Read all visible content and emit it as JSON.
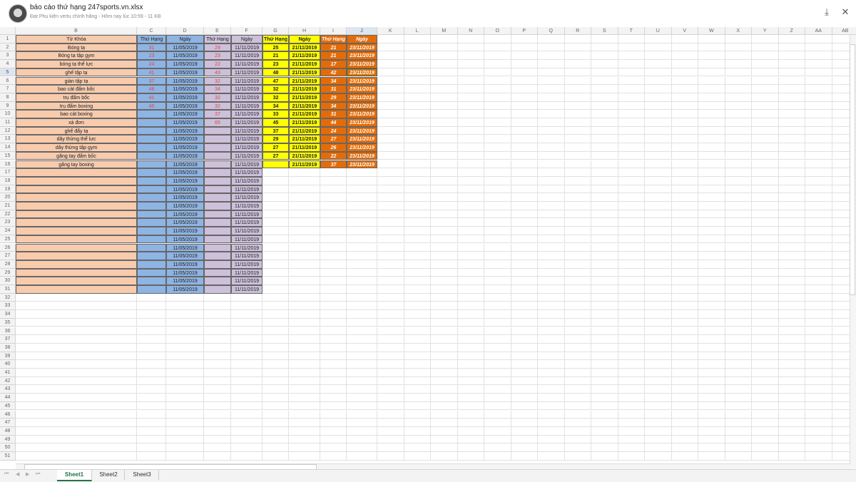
{
  "header": {
    "title": "báo cáo thứ hạng 247sports.vn.xlsx",
    "subtitle": "Đạt Phụ kiện vertu chính hãng - Hôm nay lúc 10:59 - 11 KB",
    "avatar_icon": "avatar-icon",
    "download_icon": "download-icon",
    "close_icon": "close-icon"
  },
  "columns": [
    "B",
    "C",
    "D",
    "E",
    "F",
    "G",
    "H",
    "I",
    "J",
    "K",
    "L",
    "M",
    "N",
    "O",
    "P",
    "Q",
    "R",
    "S",
    "T",
    "U",
    "V",
    "W",
    "X",
    "Y",
    "Z",
    "AA",
    "AB"
  ],
  "selected": {
    "column": "J",
    "row": "5"
  },
  "table_headers": {
    "B": "Từ Khóa",
    "C": "Thứ Hạng",
    "D": "Ngày",
    "E": "Thứ Hạng",
    "F": "Ngày",
    "G": "Thứ Hạng",
    "H": "Ngày",
    "I": "Thứ Hạng",
    "J": "Ngày"
  },
  "keywords": [
    "Bóng tạ",
    "Bóng tạ tập gym",
    "bóng tạ thể lực",
    "ghế tập tạ",
    "giàn tập tạ",
    "bao cát đấm bốc",
    "trụ đấm bốc",
    "trụ đấm boxing",
    "bao cát boxing",
    "xà đơn",
    "ghế đẩy tạ",
    "dây thừng thể lực",
    "dây thừng tập gym",
    "găng tay đấm bốc",
    "găng tay boxing"
  ],
  "rank_c": [
    "31",
    "23",
    "24",
    "41",
    "37",
    "48",
    "41",
    "45"
  ],
  "rank_e": [
    "29",
    "23",
    "22",
    "43",
    "32",
    "34",
    "32",
    "32",
    "37",
    "65"
  ],
  "rank_g": [
    "25",
    "21",
    "23",
    "48",
    "47",
    "32",
    "32",
    "34",
    "33",
    "45",
    "37",
    "29",
    "27",
    "27",
    ""
  ],
  "rank_i": [
    "21",
    "21",
    "17",
    "42",
    "34",
    "31",
    "29",
    "34",
    "31",
    "44",
    "24",
    "27",
    "26",
    "22",
    "37"
  ],
  "dates": {
    "D": "11/05/2019",
    "F": "11/11/2019",
    "H": "21/11/2019",
    "J": "23/11/2019"
  },
  "sheets": [
    "Sheet1",
    "Sheet2",
    "Sheet3"
  ],
  "active_sheet": "Sheet1",
  "colors": {
    "peach": "#f8cbad",
    "blue": "#8eb4e3",
    "lavender": "#ccc0da",
    "yellow": "#ffff00",
    "orange": "#e36c09",
    "red_text": "#e04646",
    "accent": "#217346"
  }
}
